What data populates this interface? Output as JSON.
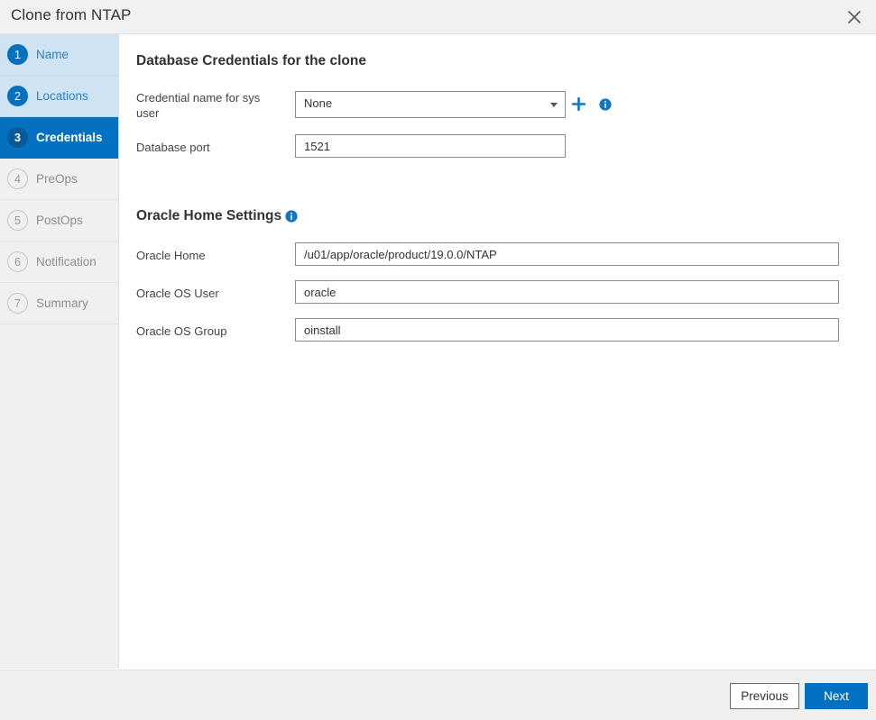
{
  "window": {
    "title": "Clone from NTAP",
    "close_label": "close-icon"
  },
  "sidebar": {
    "steps": [
      {
        "num": "1",
        "label": "Name",
        "state": "done"
      },
      {
        "num": "2",
        "label": "Locations",
        "state": "done"
      },
      {
        "num": "3",
        "label": "Credentials",
        "state": "active"
      },
      {
        "num": "4",
        "label": "PreOps",
        "state": "pending"
      },
      {
        "num": "5",
        "label": "PostOps",
        "state": "pending"
      },
      {
        "num": "6",
        "label": "Notification",
        "state": "pending"
      },
      {
        "num": "7",
        "label": "Summary",
        "state": "pending"
      }
    ]
  },
  "main": {
    "section_credentials": {
      "title": "Database Credentials for the clone",
      "credential_label": "Credential name for sys user",
      "credential_value": "None",
      "credential_options": [
        "None"
      ],
      "add_credential_icon": "plus-icon",
      "credential_info_icon": "info-icon",
      "port_label": "Database port",
      "port_value": "1521"
    },
    "section_oracle_home": {
      "title": "Oracle Home Settings",
      "info_icon": "info-icon",
      "oracle_home_label": "Oracle Home",
      "oracle_home_value": "/u01/app/oracle/product/19.0.0/NTAP",
      "os_user_label": "Oracle OS User",
      "os_user_value": "oracle",
      "os_group_label": "Oracle OS Group",
      "os_group_value": "oinstall"
    }
  },
  "footer": {
    "previous_label": "Previous",
    "next_label": "Next"
  },
  "colors": {
    "accent": "#0470c0",
    "active_step_circle": "#075a97",
    "done_step_bg": "#cfe3f2",
    "sidebar_bg": "#f0f0f0",
    "titlebar_bg": "#f1f1f1"
  }
}
